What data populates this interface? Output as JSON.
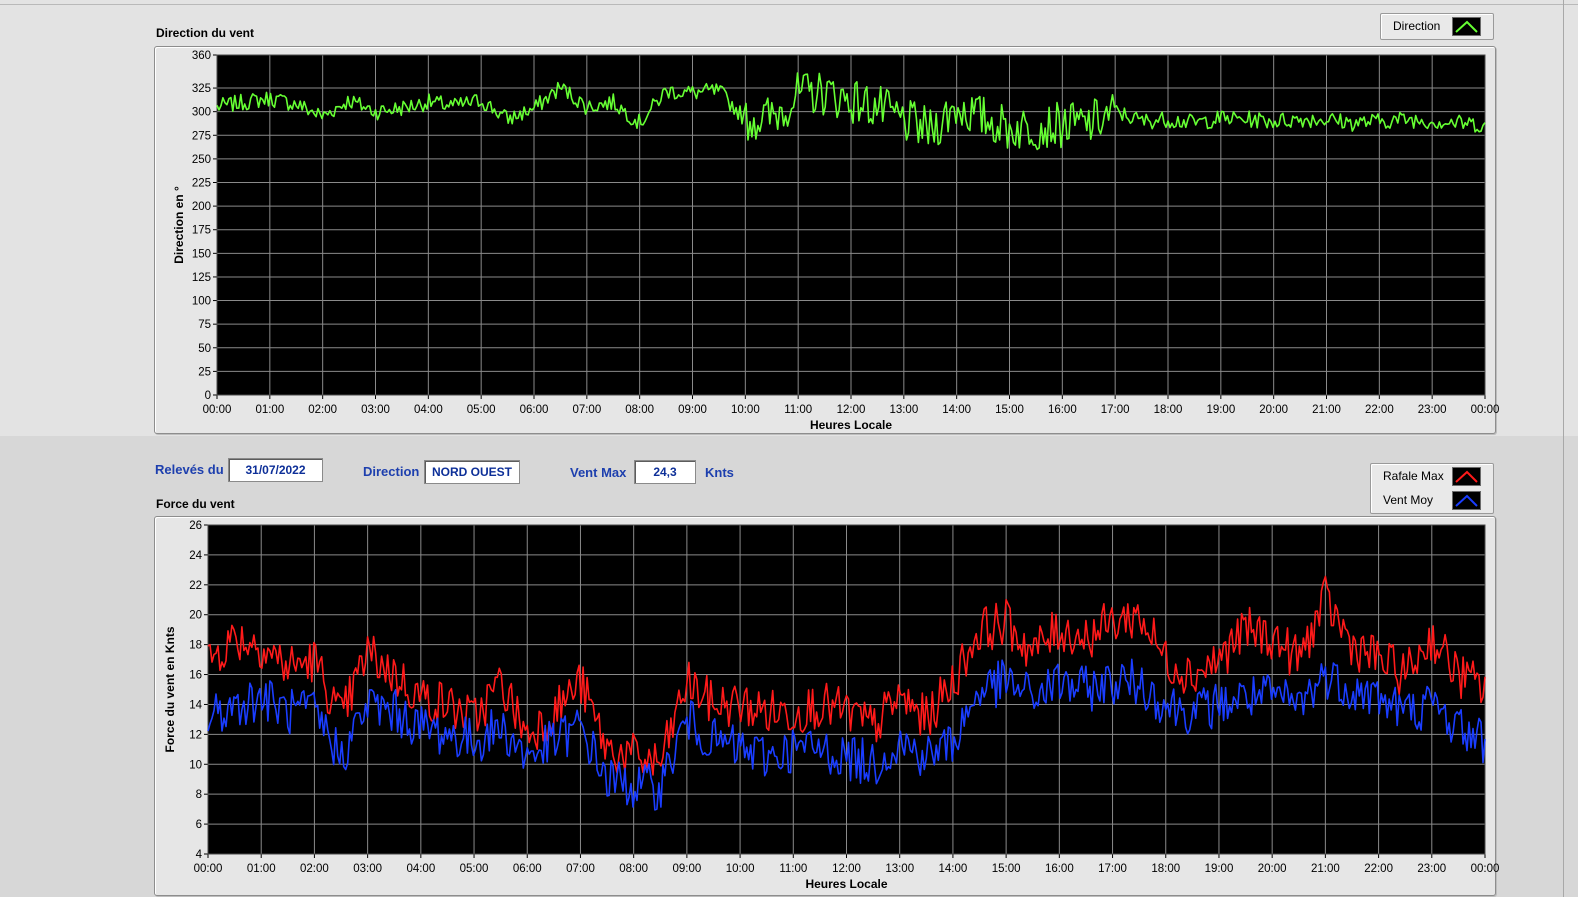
{
  "header": {
    "date_label": "Relevés du",
    "date_value": "31/07/2022",
    "direction_label": "Direction",
    "direction_value": "NORD OUEST",
    "vent_max_label": "Vent Max",
    "vent_max_value": "24,3",
    "vent_max_unit": "Knts"
  },
  "colors": {
    "plot_background": "#000000",
    "grid": "#8a8a8a",
    "direction": "#66ff33",
    "rafale": "#ff1a1a",
    "vent_moy": "#1a3dff",
    "field_text": "#0d2f98"
  },
  "chart_data": [
    {
      "type": "line",
      "title": "Direction du vent",
      "xlabel": "Heures Locale",
      "ylabel": "Direction en °",
      "ylim": [
        0,
        360
      ],
      "y_ticks": [
        "0",
        "25",
        "50",
        "75",
        "100",
        "125",
        "150",
        "175",
        "200",
        "225",
        "250",
        "275",
        "300",
        "325",
        "360"
      ],
      "x_ticks": [
        "00:00",
        "01:00",
        "02:00",
        "03:00",
        "04:00",
        "05:00",
        "06:00",
        "07:00",
        "08:00",
        "09:00",
        "10:00",
        "11:00",
        "12:00",
        "13:00",
        "14:00",
        "15:00",
        "16:00",
        "17:00",
        "18:00",
        "19:00",
        "20:00",
        "21:00",
        "22:00",
        "23:00",
        "00:00"
      ],
      "legend_position": "top-right",
      "series": [
        {
          "name": "Direction",
          "color": "#66ff33",
          "x_hours": [
            0,
            0.5,
            1,
            1.5,
            2,
            2.5,
            3,
            3.5,
            4,
            4.5,
            5,
            5.5,
            6,
            6.5,
            7,
            7.5,
            8,
            8.5,
            9,
            9.5,
            10,
            10.5,
            11,
            11.5,
            12,
            12.5,
            13,
            13.5,
            14,
            14.5,
            15,
            15.5,
            16,
            16.5,
            17,
            17.5,
            18,
            18.5,
            19,
            19.5,
            20,
            20.5,
            21,
            21.5,
            22,
            22.5,
            23,
            23.5,
            24
          ],
          "values": [
            305,
            310,
            314,
            308,
            295,
            312,
            300,
            304,
            310,
            306,
            312,
            292,
            303,
            326,
            305,
            310,
            288,
            322,
            320,
            322,
            292,
            294,
            318,
            320,
            312,
            305,
            290,
            280,
            305,
            293,
            282,
            284,
            286,
            287,
            300,
            290,
            292,
            288,
            293,
            292,
            290,
            292,
            292,
            288,
            290,
            292,
            290,
            288,
            286
          ]
        }
      ]
    },
    {
      "type": "line",
      "title": "Force du vent",
      "xlabel": "Heures Locale",
      "ylabel": "Force du vent en Knts",
      "ylim": [
        4,
        26
      ],
      "y_ticks": [
        "4",
        "6",
        "8",
        "10",
        "12",
        "14",
        "16",
        "18",
        "20",
        "22",
        "24",
        "26"
      ],
      "x_ticks": [
        "00:00",
        "01:00",
        "02:00",
        "03:00",
        "04:00",
        "05:00",
        "06:00",
        "07:00",
        "08:00",
        "09:00",
        "10:00",
        "11:00",
        "12:00",
        "13:00",
        "14:00",
        "15:00",
        "16:00",
        "17:00",
        "18:00",
        "19:00",
        "20:00",
        "21:00",
        "22:00",
        "23:00",
        "00:00"
      ],
      "legend_position": "top-right",
      "series": [
        {
          "name": "Rafale Max",
          "color": "#ff1a1a",
          "x_hours": [
            0,
            0.5,
            1,
            1.5,
            2,
            2.5,
            3,
            3.5,
            4,
            4.5,
            5,
            5.5,
            6,
            6.5,
            7,
            7.5,
            8,
            8.5,
            9,
            9.5,
            10,
            10.5,
            11,
            11.5,
            12,
            12.5,
            13,
            13.5,
            14,
            14.5,
            15,
            15.5,
            16,
            16.5,
            17,
            17.5,
            18,
            18.5,
            19,
            19.5,
            20,
            20.5,
            21,
            21.5,
            22,
            22.5,
            23,
            23.5,
            24
          ],
          "values": [
            17,
            18.5,
            18,
            16.5,
            17,
            13,
            17.5,
            16,
            14.5,
            14,
            13,
            15.5,
            12,
            13.5,
            15.5,
            11,
            10.5,
            10,
            15.5,
            14,
            14,
            13.5,
            13.5,
            14,
            13.5,
            12.5,
            14.5,
            13,
            15.5,
            19,
            19.5,
            17.5,
            19,
            18.5,
            19.5,
            20,
            17,
            16,
            17,
            19,
            18.5,
            17,
            21,
            18,
            17,
            16,
            18.5,
            16,
            15
          ]
        },
        {
          "name": "Vent Moy",
          "color": "#1a3dff",
          "x_hours": [
            0,
            0.5,
            1,
            1.5,
            2,
            2.5,
            3,
            3.5,
            4,
            4.5,
            5,
            5.5,
            6,
            6.5,
            7,
            7.5,
            8,
            8.5,
            9,
            9.5,
            10,
            10.5,
            11,
            11.5,
            12,
            12.5,
            13,
            13.5,
            14,
            14.5,
            15,
            15.5,
            16,
            16.5,
            17,
            17.5,
            18,
            18.5,
            19,
            19.5,
            20,
            20.5,
            21,
            21.5,
            22,
            22.5,
            23,
            23.5,
            24
          ],
          "values": [
            13,
            14,
            14.5,
            13.5,
            13.5,
            10.5,
            14,
            13.5,
            12.5,
            12,
            11.5,
            12.5,
            10.5,
            11.5,
            12.5,
            9,
            8.5,
            8.5,
            13,
            11.5,
            11,
            10.5,
            11,
            11,
            10.5,
            10,
            11.5,
            10.5,
            11.5,
            15,
            15.5,
            14.5,
            15.5,
            15,
            15.5,
            15.5,
            14,
            13.5,
            14,
            14.5,
            14.5,
            14,
            16,
            15,
            14.5,
            13.5,
            14,
            12.5,
            11.5
          ]
        }
      ]
    }
  ]
}
